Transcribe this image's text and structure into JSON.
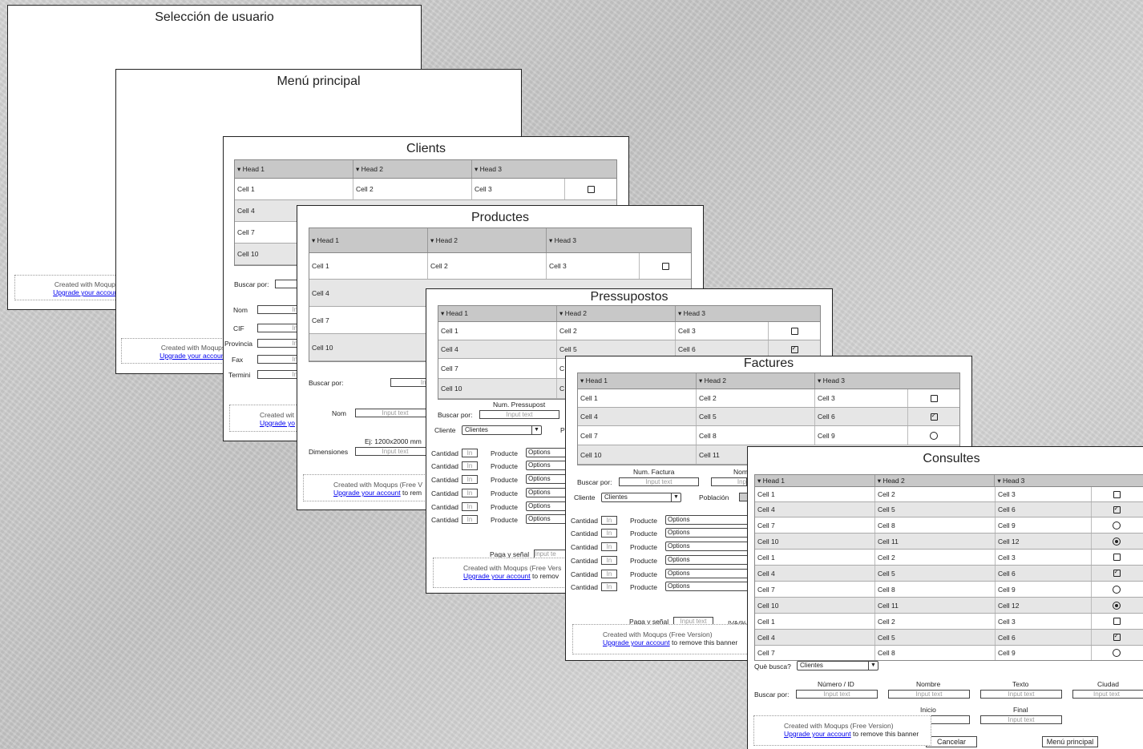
{
  "windows": {
    "user": {
      "title": "Selección de usuario"
    },
    "menu": {
      "title": "Menú principal"
    },
    "clients": {
      "title": "Clients",
      "buscar": "Buscar por:",
      "fields": [
        "Nom",
        "CIF",
        "Provincia",
        "Fax",
        "Termini"
      ],
      "field_input": "Inpu",
      "partial_label": "Pr"
    },
    "productes": {
      "title": "Productes",
      "buscar": "Buscar por:",
      "buscar_input": "Inp",
      "nom": "Nom",
      "nom_input": "Input text",
      "dim_hint": "Ej: 1200x2000 mm",
      "dim": "Dimensiones",
      "dim_input": "Input text"
    },
    "pressupostos": {
      "title": "Pressupostos",
      "num": "Num. Pressupost",
      "buscar": "Buscar por:",
      "buscar_input": "Input text",
      "cliente": "Cliente",
      "cliente_val": "Clientes",
      "cliente_p": "P",
      "cantidad": "Cantidad",
      "in": "In",
      "producte": "Producte",
      "options": "Options",
      "paga": "Paga y señal",
      "paga_input": "Input te"
    },
    "factures": {
      "title": "Factures",
      "num": "Num. Factura",
      "nom_partial": "Nom",
      "buscar": "Buscar por:",
      "buscar_input": "Input text",
      "buscar_input2": "Inp",
      "cliente": "Cliente",
      "cliente_val": "Clientes",
      "poblacion": "Población",
      "cantidad": "Cantidad",
      "in": "In",
      "producte": "Producte",
      "options": "Options",
      "paga": "Paga y señal",
      "paga_input": "Input text",
      "iva": "IVA(%"
    },
    "consultes": {
      "title": "Consultes",
      "que": "Què busca?",
      "que_val": "Clientes",
      "buscar": "Buscar por:",
      "cols": [
        "Número / ID",
        "Nombre",
        "Texto",
        "Ciudad"
      ],
      "input": "Input text",
      "inicio": "Inicio",
      "final": "Final",
      "inicio_input": "xt",
      "cancelar": "Cancelar",
      "menu_btn": "Menú principal"
    }
  },
  "table": {
    "heads": [
      "▾ Head 1",
      "▾ Head 2",
      "▾ Head 3"
    ],
    "rows": [
      [
        "Cell 1",
        "Cell 2",
        "Cell 3"
      ],
      [
        "Cell 4",
        "Cell 5",
        "Cell 6"
      ],
      [
        "Cell 7",
        "Cell 8",
        "Cell 9"
      ],
      [
        "Cell 10",
        "Cell 11",
        "Cell 12"
      ]
    ],
    "cells_partial": {
      "c_clip": "C"
    }
  },
  "banner": {
    "created": "Created with Moqups",
    "created_full": "Created with Moqups (Free Version)",
    "created_partial": "Created with Moqups (Free V",
    "created_partial2": "Created with Moqups (Free Vers",
    "created_short": "Created wit",
    "upgrade": "Upgrade your account",
    "upgrade_short": "Upgrade your",
    "upgrade_tiny": "Upgrade yo",
    "upgrade_tail": "Upgrade you",
    "remove": " to remove this banner",
    "remove_partial": " to rem",
    "remove_partial2": " to remov"
  }
}
